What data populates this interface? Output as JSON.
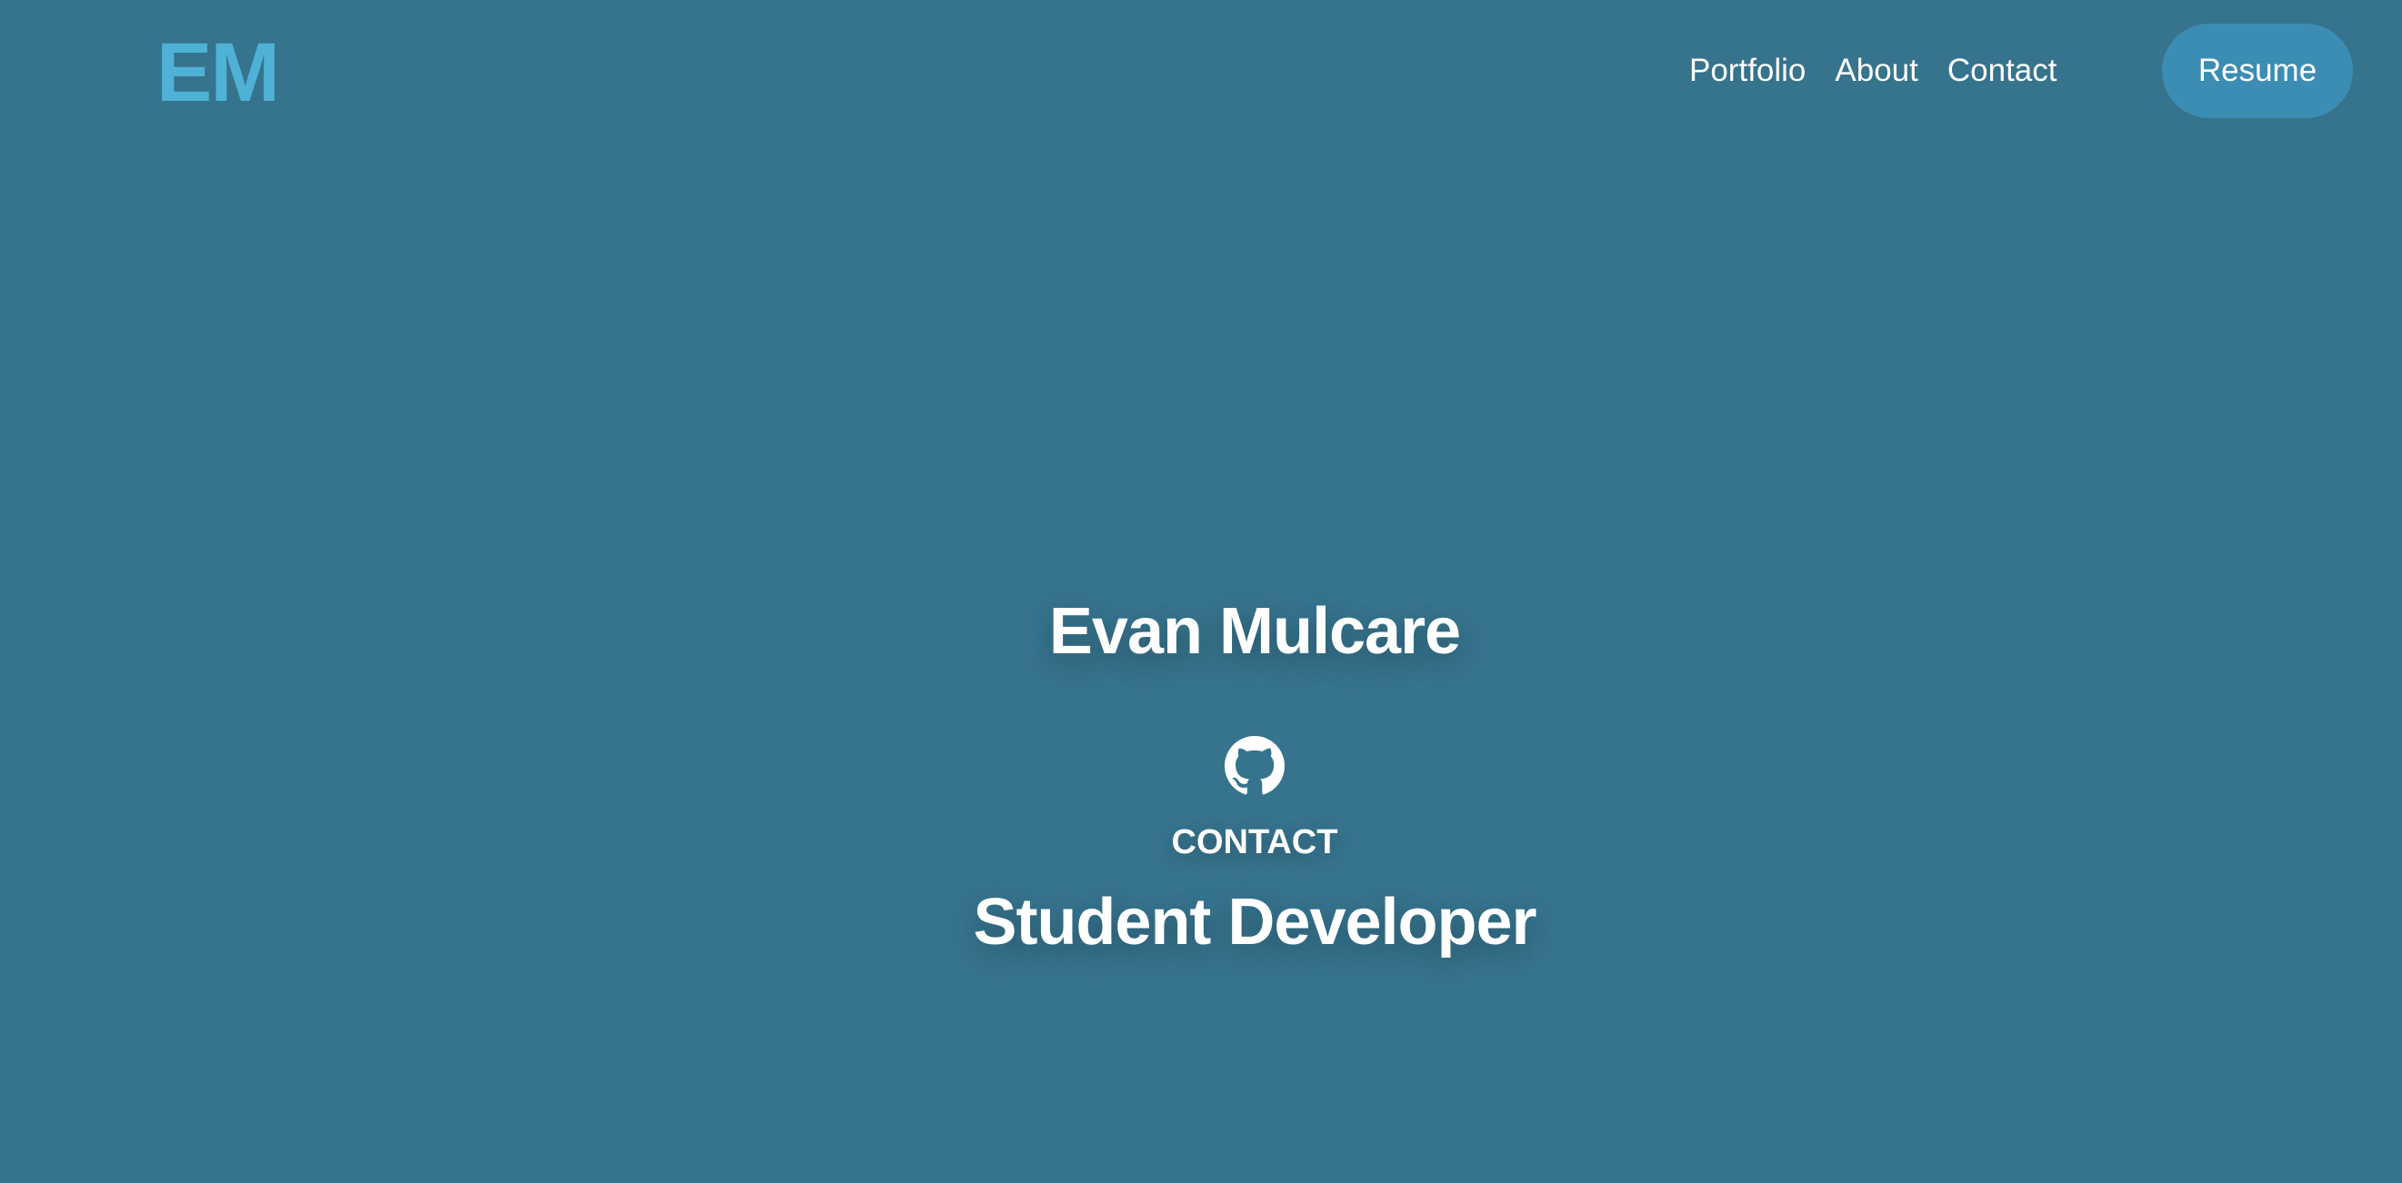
{
  "header": {
    "logo_text": "EM",
    "nav": [
      {
        "label": "Portfolio"
      },
      {
        "label": "About"
      },
      {
        "label": "Contact"
      }
    ],
    "resume_label": "Resume"
  },
  "hero": {
    "name": "Evan Mulcare",
    "github_icon": "github-icon",
    "contact_label": "CONTACT",
    "role": "Student Developer"
  },
  "colors": {
    "background": "#36738d",
    "logo": "#4fb1d6",
    "button": "#3c8db4",
    "text": "#ffffff"
  }
}
